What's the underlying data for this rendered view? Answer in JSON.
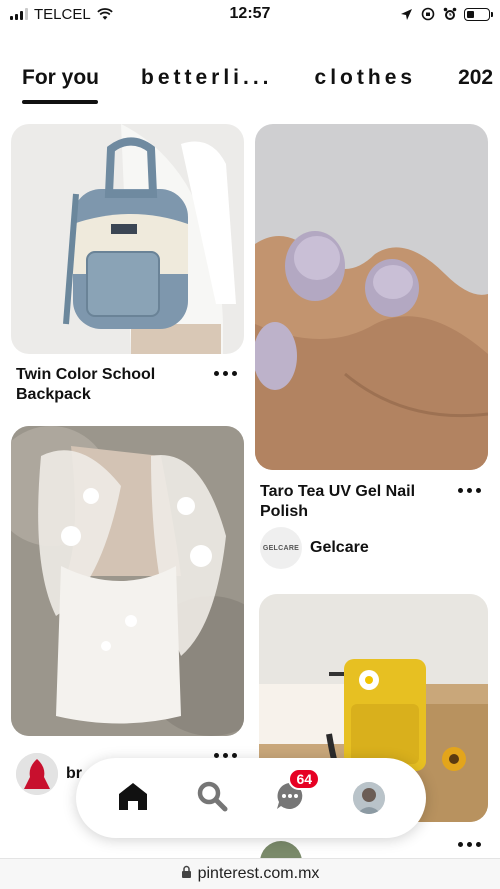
{
  "status_bar": {
    "carrier": "TELCEL",
    "time": "12:57",
    "battery_level": 0.35
  },
  "tabs": [
    {
      "label": "For you",
      "active": true
    },
    {
      "label": "betterli...",
      "active": false
    },
    {
      "label": "clothes",
      "active": false
    },
    {
      "label": "202",
      "active": false
    }
  ],
  "pins": [
    {
      "title_line1": "Twin Color School",
      "title_line2": "Backpack",
      "image": "backpack-photo"
    },
    {
      "title_line1": "Taro Tea UV Gel Nail",
      "title_line2": "Polish",
      "image": "nail-polish-photo",
      "creator_name": "Gelcare",
      "creator_avatar_text": "GELCARE"
    },
    {
      "image": "lace-dress-photo",
      "creator_name": "br"
    },
    {
      "image": "yellow-bag-photo"
    }
  ],
  "bottom_nav": {
    "items": [
      {
        "name": "home",
        "icon": "home-icon"
      },
      {
        "name": "search",
        "icon": "search-icon"
      },
      {
        "name": "messages",
        "icon": "chat-icon",
        "badge": "64"
      },
      {
        "name": "profile",
        "icon": "avatar"
      }
    ]
  },
  "url_bar": {
    "url": "pinterest.com.mx"
  },
  "colors": {
    "badge": "#e60023",
    "text": "#111111"
  }
}
